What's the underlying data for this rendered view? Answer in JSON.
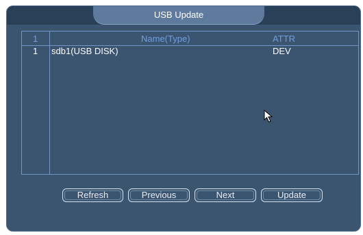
{
  "window": {
    "title": "USB Update"
  },
  "table": {
    "columns": {
      "index": "1",
      "name": "Name(Type)",
      "attr": "ATTR"
    },
    "rows": [
      {
        "index": "1",
        "name": "sdb1(USB DISK)",
        "attr": "DEV"
      }
    ]
  },
  "buttons": {
    "refresh": "Refresh",
    "previous": "Previous",
    "next": "Next",
    "update": "Update"
  },
  "colors": {
    "panel_bg": "#3b5470",
    "title_tab_bg": "#5e7b9e",
    "grid_line": "#6f97c7",
    "header_text": "#6f9fe3"
  }
}
